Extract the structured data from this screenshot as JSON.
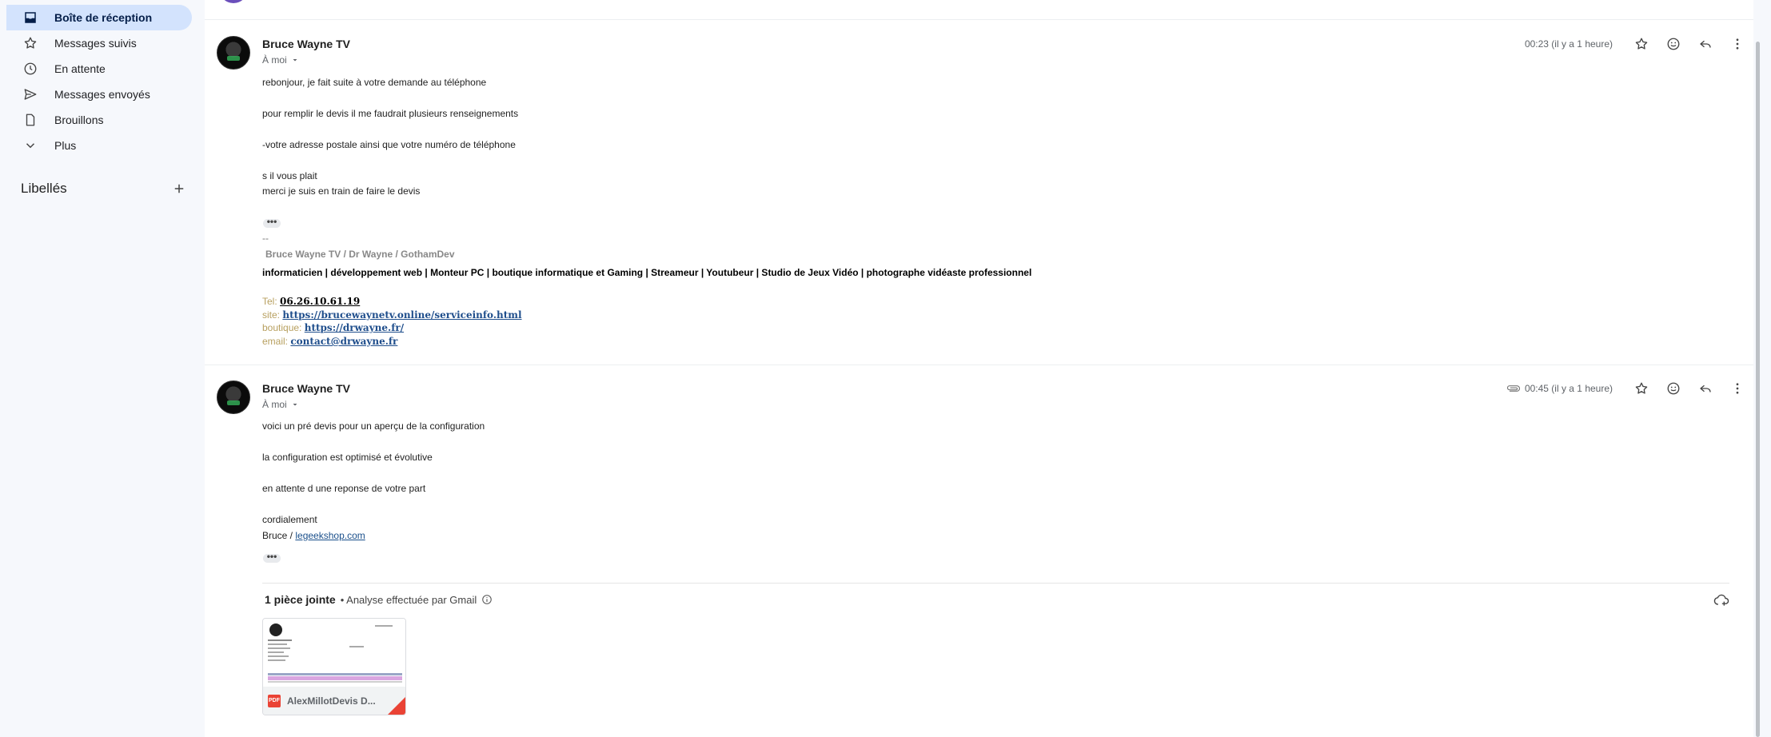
{
  "sidebar": {
    "items": [
      {
        "label": "Boîte de réception",
        "icon": "inbox-icon",
        "active": true
      },
      {
        "label": "Messages suivis",
        "icon": "star-icon",
        "active": false
      },
      {
        "label": "En attente",
        "icon": "clock-icon",
        "active": false
      },
      {
        "label": "Messages envoyés",
        "icon": "send-icon",
        "active": false
      },
      {
        "label": "Brouillons",
        "icon": "draft-icon",
        "active": false
      },
      {
        "label": "Plus",
        "icon": "chevron-down-icon",
        "active": false
      }
    ],
    "labels_title": "Libellés"
  },
  "messages": [
    {
      "sender": "Bruce Wayne TV",
      "to": "À moi",
      "time": "00:23 (il y a 1 heure)",
      "body": [
        "rebonjour, je fait suite à votre demande au téléphone",
        "pour remplir le devis il me faudrait plusieurs renseignements",
        "-votre adresse postale ainsi que votre numéro de téléphone",
        "s il vous plait",
        "merci je suis en train de faire le devis"
      ],
      "signature": {
        "dash": "--",
        "name": "Bruce Wayne TV / Dr Wayne / GothamDev",
        "tagline": "informaticien | développement web | Monteur PC | boutique informatique et Gaming | Streameur | Youtubeur | Studio de Jeux Vidéo | photographe vidéaste professionnel",
        "tel_label": "Tel:",
        "tel": "06.26.10.61.19",
        "site_label": "site:",
        "site": "https://brucewaynetv.online/serviceinfo.html",
        "shop_label": "boutique:",
        "shop": "https://drwayne.fr/",
        "email_label": "email:",
        "email": "contact@drwayne.fr"
      }
    },
    {
      "sender": "Bruce Wayne TV",
      "to": "À moi",
      "time": "00:45 (il y a 1 heure)",
      "body": [
        "voici un pré devis  pour un aperçu de la configuration",
        "la configuration est optimisé et évolutive",
        "en attente d une reponse de votre part",
        "cordialement"
      ],
      "sign_prefix": "Bruce / ",
      "sign_link": "legeekshop.com",
      "attachments": {
        "count_label": "1 pièce jointe",
        "scan_label": "• Analyse effectuée par Gmail",
        "file_type": "PDF",
        "file_name": "AlexMillotDevis D..."
      }
    }
  ],
  "colors": {
    "active_nav": "#d3e3fd",
    "background": "#f6f8fc",
    "link": "#1f4e8c",
    "pdf_red": "#ea4335"
  }
}
